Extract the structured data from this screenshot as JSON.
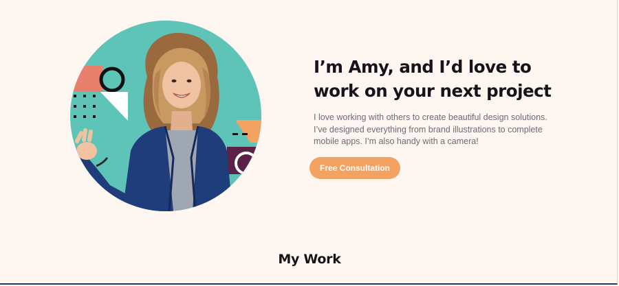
{
  "hero": {
    "heading_line1": "I’m Amy, and I’d love to",
    "heading_line2": "work on your next project",
    "intro_line1": "I love working with others to create beautiful design solutions.",
    "intro_line2": "I’ve designed everything from brand illustrations to complete",
    "intro_line3": "mobile apps. I’m also handy with a camera!",
    "cta_label": "Free Consultation",
    "portrait_icon": "portrait-photo-icon"
  },
  "work": {
    "title": "My Work"
  },
  "colors": {
    "page_background": "#fef7f1",
    "heading": "#16141a",
    "body_text": "#6d6a72",
    "accent_orange": "#f4a261",
    "portrait_teal": "#5fc4b8",
    "shape_coral": "#e9806e",
    "shape_plum": "#5b2146",
    "jacket_blue": "#1f3d7a"
  }
}
